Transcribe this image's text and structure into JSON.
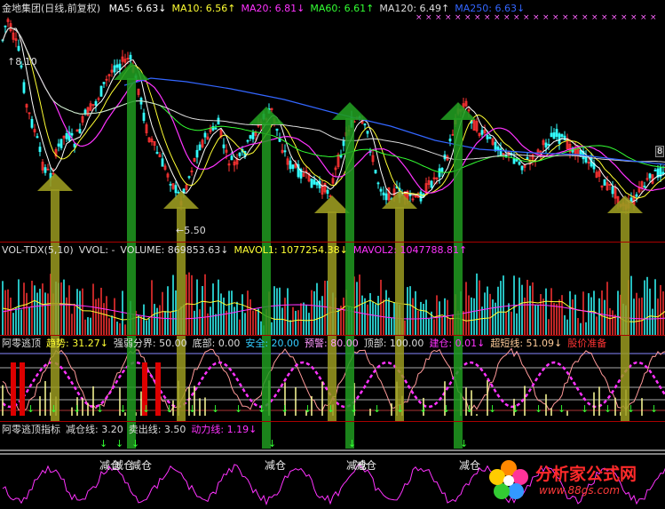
{
  "main_panel": {
    "stock_name": "金地集团(日线,前复权)",
    "ma": [
      {
        "label": "MA5:",
        "value": "6.63",
        "arrow": "↓",
        "color": "#ffffff"
      },
      {
        "label": "MA10:",
        "value": "6.56",
        "arrow": "↑",
        "color": "#ffff33"
      },
      {
        "label": "MA20:",
        "value": "6.81",
        "arrow": "↓",
        "color": "#ff33ff"
      },
      {
        "label": "MA60:",
        "value": "6.61",
        "arrow": "↑",
        "color": "#33ff33"
      },
      {
        "label": "MA120:",
        "value": "6.49",
        "arrow": "↑",
        "color": "#dddddd"
      },
      {
        "label": "MA250:",
        "value": "6.63",
        "arrow": "↓",
        "color": "#3366ff"
      }
    ],
    "high_label": "8.10",
    "low_label": "5.50",
    "right_marker": "8"
  },
  "volume_panel": {
    "items": [
      {
        "text": "VOL-TDX(5,10)",
        "color": "#dddddd"
      },
      {
        "text": "VVOL: -",
        "color": "#dddddd"
      },
      {
        "text": "VOLUME: 869853.63↓",
        "color": "#dddddd"
      },
      {
        "text": "MAVOL1: 1077254.38↓",
        "color": "#ffff33"
      },
      {
        "text": "MAVOL2: 1047788.81↑",
        "color": "#ff33ff"
      }
    ]
  },
  "escape_panel": {
    "items": [
      {
        "text": "阿零逃顶",
        "color": "#dddddd"
      },
      {
        "text": "趋势: 31.27↓",
        "color": "#ffff33"
      },
      {
        "text": "强弱分界: 50.00",
        "color": "#dddddd"
      },
      {
        "text": "底部: 0.00",
        "color": "#dddddd"
      },
      {
        "text": "安全: 20.00",
        "color": "#33ccff"
      },
      {
        "text": "预警: 80.00",
        "color": "#ff99ff"
      },
      {
        "text": "顶部: 100.00",
        "color": "#dddddd"
      },
      {
        "text": "建仓: 0.01↓",
        "color": "#ff33ff"
      },
      {
        "text": "超短线: 51.09↓",
        "color": "#ffcc99"
      },
      {
        "text": "股价准备",
        "color": "#ff3333"
      }
    ]
  },
  "indicator_panel": {
    "items": [
      {
        "text": "阿零逃顶指标",
        "color": "#dddddd"
      },
      {
        "text": "减仓线: 3.20",
        "color": "#dddddd"
      },
      {
        "text": "卖出线: 3.50",
        "color": "#dddddd"
      },
      {
        "text": "动力线: 1.19↓",
        "color": "#ff33ff"
      }
    ],
    "reduce_labels": [
      "减仓",
      "减仓",
      "减仓",
      "减仓",
      "减仓",
      "减仓",
      "减仓"
    ]
  },
  "watermark": {
    "title": "分析家公式网",
    "url": "www.88gs.com"
  }
}
